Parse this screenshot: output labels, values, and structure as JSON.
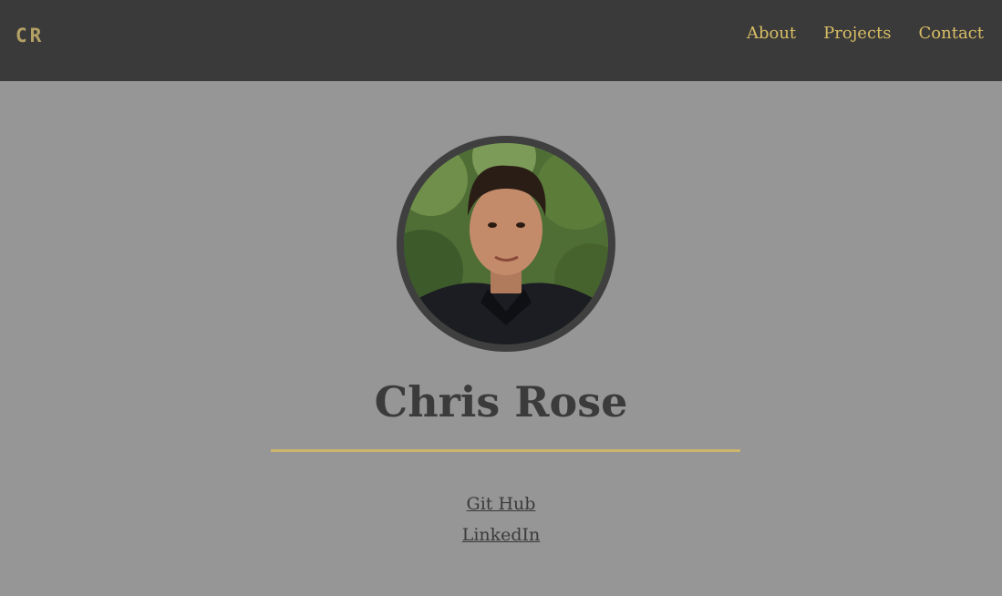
{
  "header": {
    "logo_text": "CR",
    "nav": [
      {
        "label": "About"
      },
      {
        "label": "Projects"
      },
      {
        "label": "Contact"
      }
    ]
  },
  "profile": {
    "name": "Chris Rose",
    "photo_icon": "profile-photo"
  },
  "social": {
    "github_label": "Git Hub",
    "linkedin_label": "LinkedIn"
  },
  "colors": {
    "background": "#969696",
    "navbar": "#3a3a3a",
    "accent": "#d8bd65",
    "text": "#3b3b3b"
  }
}
